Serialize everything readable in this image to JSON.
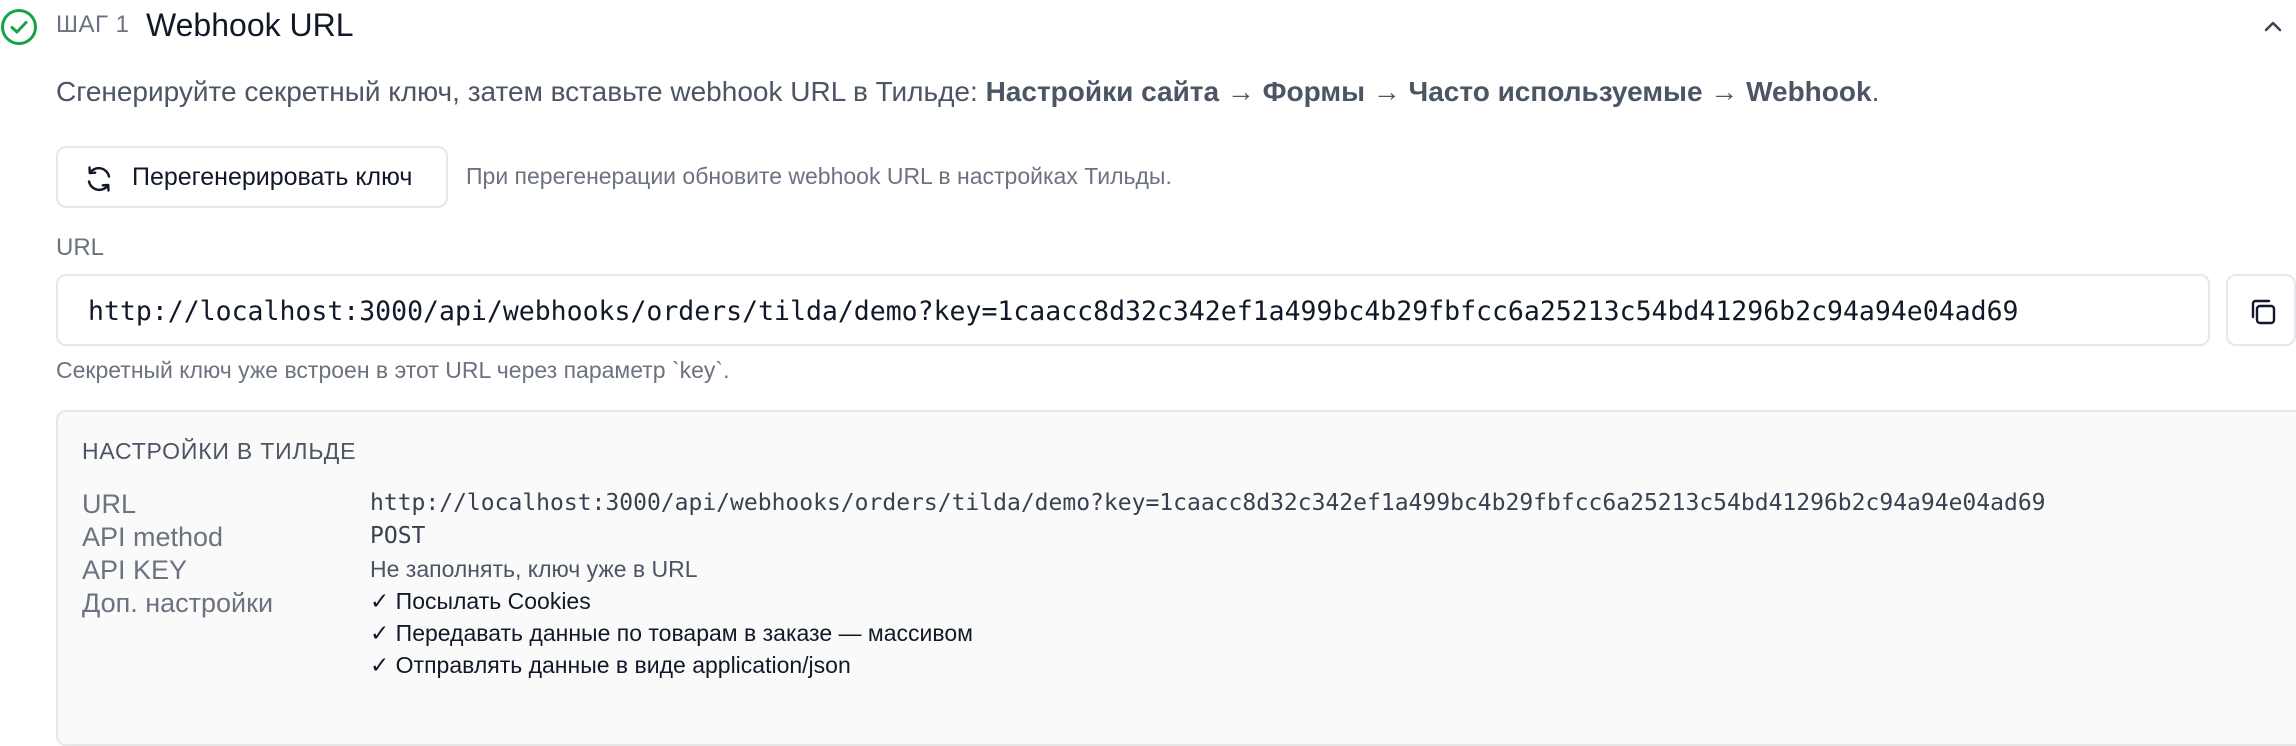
{
  "colors": {
    "accent_green": "#16a34a",
    "border": "#e5e7eb",
    "muted_text": "#6b7280",
    "panel_bg": "#fafafa"
  },
  "icons": {
    "step_status": "check-circle-icon",
    "collapse": "chevron-up-icon",
    "regenerate": "refresh-icon",
    "copy": "copy-icon"
  },
  "step": {
    "label": "ШАГ 1",
    "title": "Webhook URL"
  },
  "intro": {
    "text": "Сгенерируйте секретный ключ, затем вставьте webhook URL в Тильде: ",
    "path": "Настройки сайта → Формы → Часто используемые → Webhook",
    "end": "."
  },
  "regenerate": {
    "button_label": "Перегенерировать ключ",
    "hint": "При перегенерации обновите webhook URL в настройках Тильды."
  },
  "url_field": {
    "label": "URL",
    "value": "http://localhost:3000/api/webhooks/orders/tilda/demo?key=1caacc8d32c342ef1a499bc4b29fbfcc6a25213c54bd41296b2c94a94e04ad69",
    "hint": "Секретный ключ уже встроен в этот URL через параметр `key`."
  },
  "settings": {
    "heading": "НАСТРОЙКИ В ТИЛЬДЕ",
    "rows": [
      {
        "key": "URL",
        "value": "http://localhost:3000/api/webhooks/orders/tilda/demo?key=1caacc8d32c342ef1a499bc4b29fbfcc6a25213c54bd41296b2c94a94e04ad69"
      },
      {
        "key": "API method",
        "value": "POST"
      },
      {
        "key": "API KEY",
        "value": "Не заполнять, ключ уже в URL"
      },
      {
        "key": "Доп. настройки",
        "options": [
          "✓ Посылать Cookies",
          "✓ Передавать данные по товарам в заказе — массивом",
          "✓ Отправлять данные в виде application/json"
        ]
      }
    ]
  }
}
